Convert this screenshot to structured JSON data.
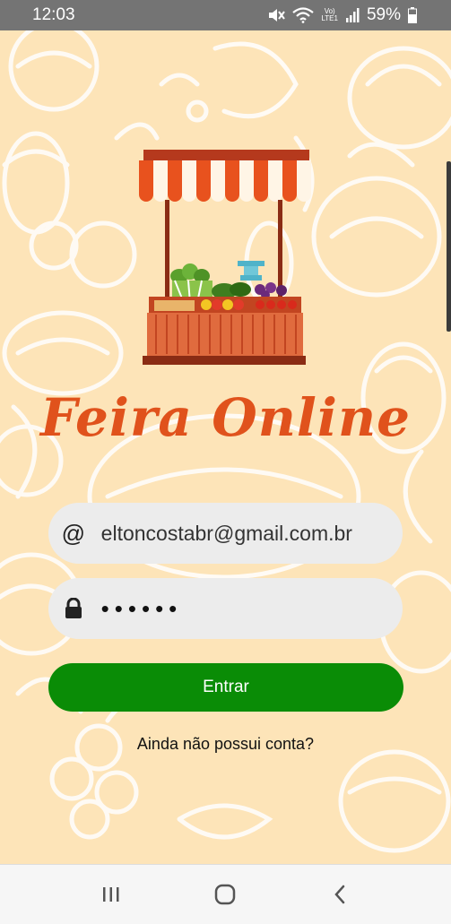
{
  "status_bar": {
    "time": "12:03",
    "network_label": "Vo)\nLTE1",
    "battery": "59%",
    "icons": [
      "mute-icon",
      "wifi-icon",
      "signal-icon",
      "battery-icon"
    ]
  },
  "app": {
    "title": "Feira Online",
    "logo": "market-stall-logo",
    "title_color": "#e0521c",
    "background_color": "#fde4b8"
  },
  "form": {
    "email_value": "eltoncostabr@gmail.com.br",
    "email_icon": "@",
    "password_value": "••••••",
    "login_label": "Entrar",
    "login_color": "#0a8c06",
    "signup_label": "Ainda não possui conta?"
  },
  "nav_bar": {
    "buttons": [
      "recent-apps-icon",
      "home-icon",
      "back-icon"
    ]
  }
}
